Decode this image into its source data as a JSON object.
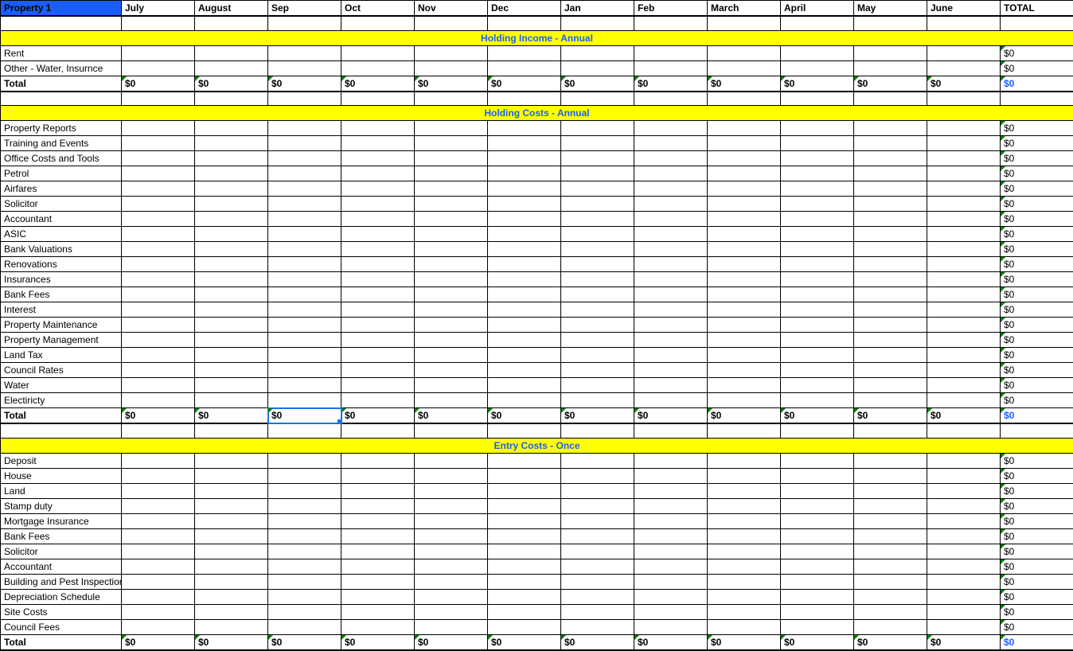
{
  "header": {
    "title": "Property 1",
    "months": [
      "July",
      "August",
      "Sep",
      "Oct",
      "Nov",
      "Dec",
      "Jan",
      "Feb",
      "March",
      "April",
      "May",
      "June"
    ],
    "total_label": "TOTAL"
  },
  "zero": "$0",
  "sections": [
    {
      "title": "Holding Income - Annual",
      "rows": [
        "Rent",
        "Other - Water, Insurnce"
      ],
      "total_label": "Total"
    },
    {
      "title": "Holding Costs - Annual",
      "rows": [
        "Property Reports",
        "Training and Events",
        "Office Costs and Tools",
        "Petrol",
        "Airfares",
        "Solicitor",
        "Accountant",
        "ASIC",
        "Bank Valuations",
        "Renovations",
        "Insurances",
        "Bank Fees",
        "Interest",
        "Property Maintenance",
        "Property Management",
        "Land Tax",
        "Council Rates",
        "Water",
        "Electiricty"
      ],
      "total_label": "Total"
    },
    {
      "title": "Entry Costs - Once",
      "rows": [
        "Deposit",
        "House",
        "Land",
        "Stamp duty",
        "Mortgage Insurance",
        "Bank Fees",
        "Solicitor",
        "Accountant",
        "Building and Pest Inspection",
        "Depreciation Schedule",
        "Site Costs",
        "Council Fees"
      ],
      "total_label": "Total"
    }
  ],
  "selected": {
    "section": 1,
    "type": "total",
    "col": 2
  }
}
